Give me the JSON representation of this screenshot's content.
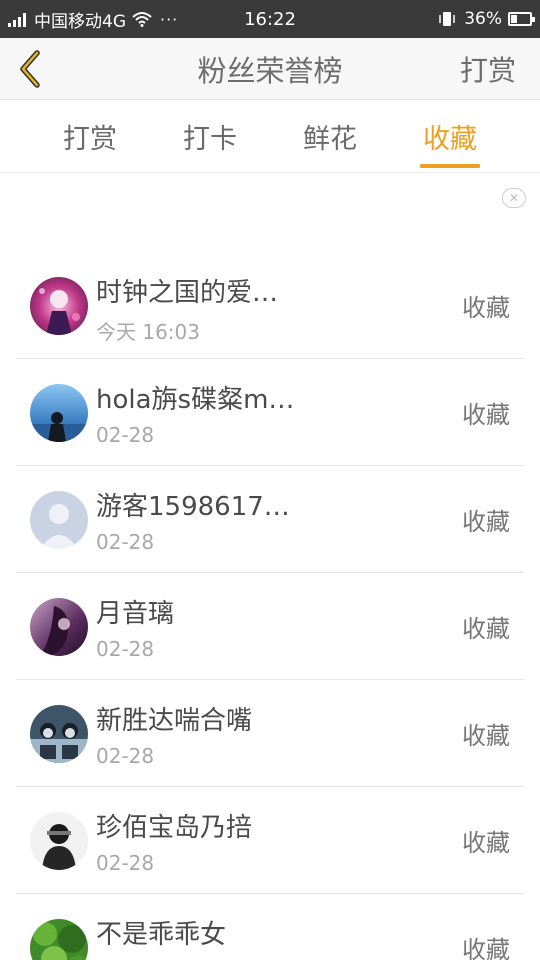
{
  "status_bar": {
    "carrier": "中国移动4G",
    "more": "···",
    "time": "16:22",
    "battery_percent": "36%",
    "battery_level": 0.36,
    "signal_icon": "cellular-signal-icon",
    "wifi_icon": "wifi-icon",
    "vibrate_icon": "vibrate-icon",
    "battery_icon": "battery-icon"
  },
  "header": {
    "title": "粉丝荣誉榜",
    "action_label": "打赏",
    "back_icon": "chevron-left-icon"
  },
  "tabs": [
    {
      "label": "打赏",
      "active": false
    },
    {
      "label": "打卡",
      "active": false
    },
    {
      "label": "鲜花",
      "active": false
    },
    {
      "label": "收藏",
      "active": true
    }
  ],
  "ad_close_icon": "close-icon",
  "list": [
    {
      "name": "时钟之国的爱…",
      "date": "今天 16:03",
      "action": "收藏",
      "avatar": "anime-girl-avatar"
    },
    {
      "name": "hola旃s碟粲m…",
      "date": "02-28",
      "action": "收藏",
      "avatar": "sky-silhouette-avatar"
    },
    {
      "name": "游客1598617…",
      "date": "02-28",
      "action": "收藏",
      "avatar": "default-user-avatar"
    },
    {
      "name": "月音璃",
      "date": "02-28",
      "action": "收藏",
      "avatar": "dark-purple-avatar"
    },
    {
      "name": "新胜达喘合嘴",
      "date": "02-28",
      "action": "收藏",
      "avatar": "duo-avatar"
    },
    {
      "name": "珍佰宝岛乃掊",
      "date": "02-28",
      "action": "收藏",
      "avatar": "dark-figure-avatar"
    },
    {
      "name": "不是乖乖女",
      "date": "",
      "action": "收藏",
      "avatar": "green-nature-avatar"
    }
  ],
  "colors": {
    "accent": "#f0a020",
    "status_bar_bg": "#3a3a3a",
    "header_bg": "#f7f7f7",
    "text_primary": "#4a4a4a",
    "text_secondary": "#a8a8a8"
  }
}
